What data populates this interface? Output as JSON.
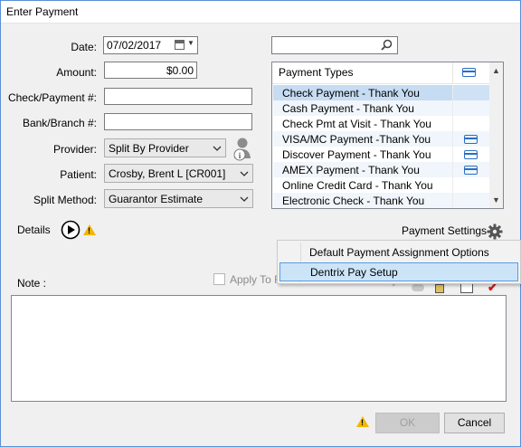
{
  "window": {
    "title": "Enter Payment"
  },
  "form": {
    "date_label": "Date:",
    "date_value": "07/02/2017",
    "amount_label": "Amount:",
    "amount_value": "$0.00",
    "check_label": "Check/Payment #:",
    "check_value": "",
    "bank_label": "Bank/Branch #:",
    "bank_value": "",
    "provider_label": "Provider:",
    "provider_value": "Split By Provider",
    "patient_label": "Patient:",
    "patient_value": "Crosby, Brent L [CR001]",
    "split_label": "Split Method:",
    "split_value": "Guarantor Estimate"
  },
  "search": {
    "value": "",
    "icon": "search-icon"
  },
  "payment_types": {
    "header": "Payment Types",
    "items": [
      {
        "label": "Check Payment - Thank You",
        "card": false,
        "selected": true
      },
      {
        "label": "Cash Payment - Thank You",
        "card": false,
        "selected": false
      },
      {
        "label": "Check Pmt at Visit - Thank You",
        "card": false,
        "selected": false
      },
      {
        "label": "VISA/MC Payment -Thank You",
        "card": true,
        "selected": false
      },
      {
        "label": "Discover Payment - Thank You",
        "card": true,
        "selected": false
      },
      {
        "label": "AMEX Payment - Thank You",
        "card": true,
        "selected": false
      },
      {
        "label": "Online Credit Card - Thank You",
        "card": false,
        "selected": false
      },
      {
        "label": "Electronic Check - Thank You",
        "card": false,
        "selected": false
      }
    ]
  },
  "details": {
    "label": "Details"
  },
  "payment_settings": {
    "label": "Payment Settings"
  },
  "menu": {
    "items": [
      {
        "label": "Default Payment Assignment Options",
        "highlighted": false
      },
      {
        "label": "Dentrix Pay Setup",
        "highlighted": true
      }
    ]
  },
  "note": {
    "label": "Note :",
    "value": ""
  },
  "apply": {
    "label": "Apply To F",
    "checked": false
  },
  "buttons": {
    "ok": "OK",
    "cancel": "Cancel"
  },
  "colors": {
    "accent": "#2a6ec1",
    "selected_row": "#c6dcf2",
    "menu_highlight": "#cce4f7",
    "warning": "#f2b705"
  }
}
